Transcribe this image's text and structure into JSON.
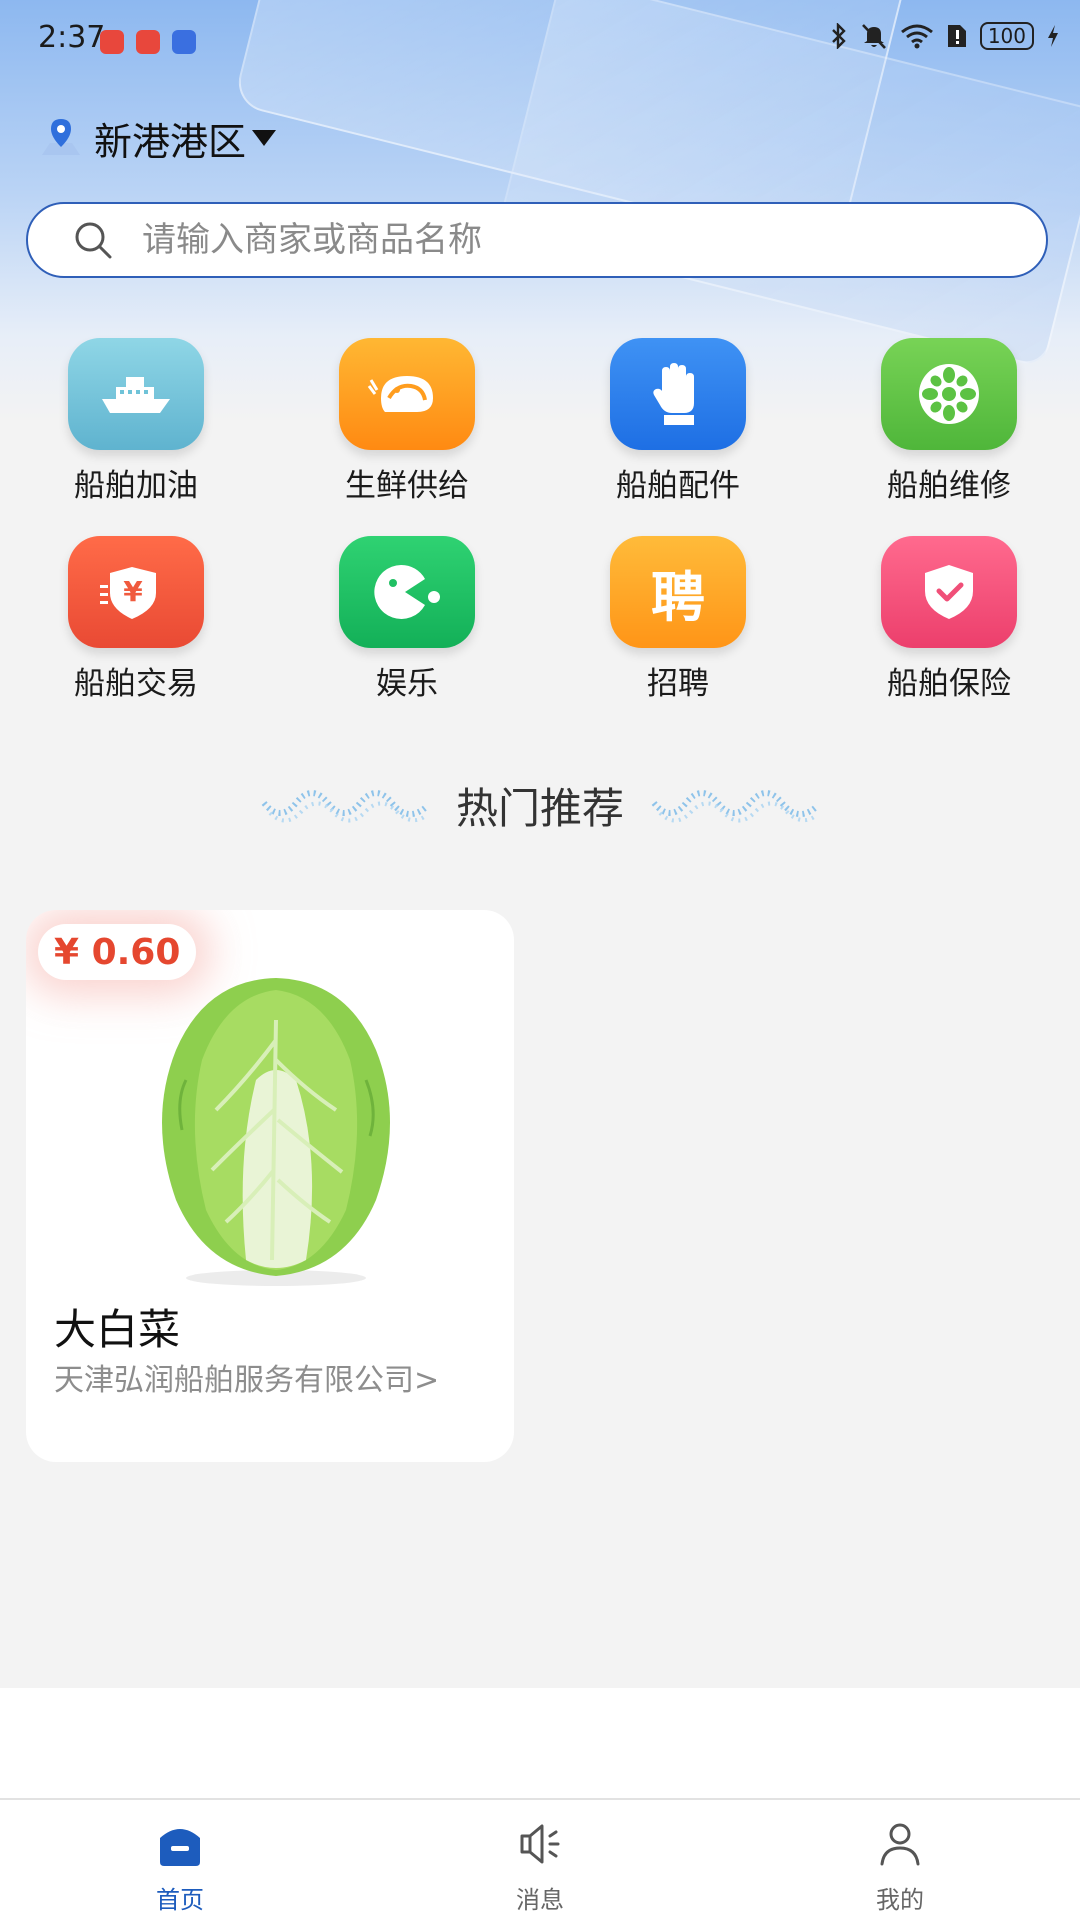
{
  "status_bar": {
    "time": "2:37",
    "battery": "100"
  },
  "location": {
    "label": "新港港区"
  },
  "search": {
    "placeholder": "请输入商家或商品名称"
  },
  "categories": [
    {
      "label": "船舶加油",
      "icon": "ship-icon",
      "color": "#6fc3d8"
    },
    {
      "label": "生鲜供给",
      "icon": "shrimp-icon",
      "color": "#ff9d1e"
    },
    {
      "label": "船舶配件",
      "icon": "glove-icon",
      "color": "#2f83f0"
    },
    {
      "label": "船舶维修",
      "icon": "wheel-icon",
      "color": "#5cc243"
    },
    {
      "label": "船舶交易",
      "icon": "yuan-shield-icon",
      "color": "#f05a3e"
    },
    {
      "label": "娱乐",
      "icon": "game-icon",
      "color": "#20c063"
    },
    {
      "label": "招聘",
      "icon": "recruit-icon",
      "color": "#ffa31e",
      "glyph": "聘"
    },
    {
      "label": "船舶保险",
      "icon": "insurance-shield-icon",
      "color": "#f04f78"
    }
  ],
  "section": {
    "title": "热门推荐"
  },
  "products": [
    {
      "price": "¥ 0.60",
      "name": "大白菜",
      "seller": "天津弘润船舶服务有限公司>"
    }
  ],
  "tabbar": {
    "items": [
      {
        "label": "首页",
        "icon": "home-icon",
        "active": true
      },
      {
        "label": "消息",
        "icon": "speaker-icon",
        "active": false
      },
      {
        "label": "我的",
        "icon": "user-icon",
        "active": false
      }
    ]
  },
  "colors": {
    "accent": "#1d5cbd",
    "price": "#e5472f",
    "inactive_tab": "#666666"
  }
}
